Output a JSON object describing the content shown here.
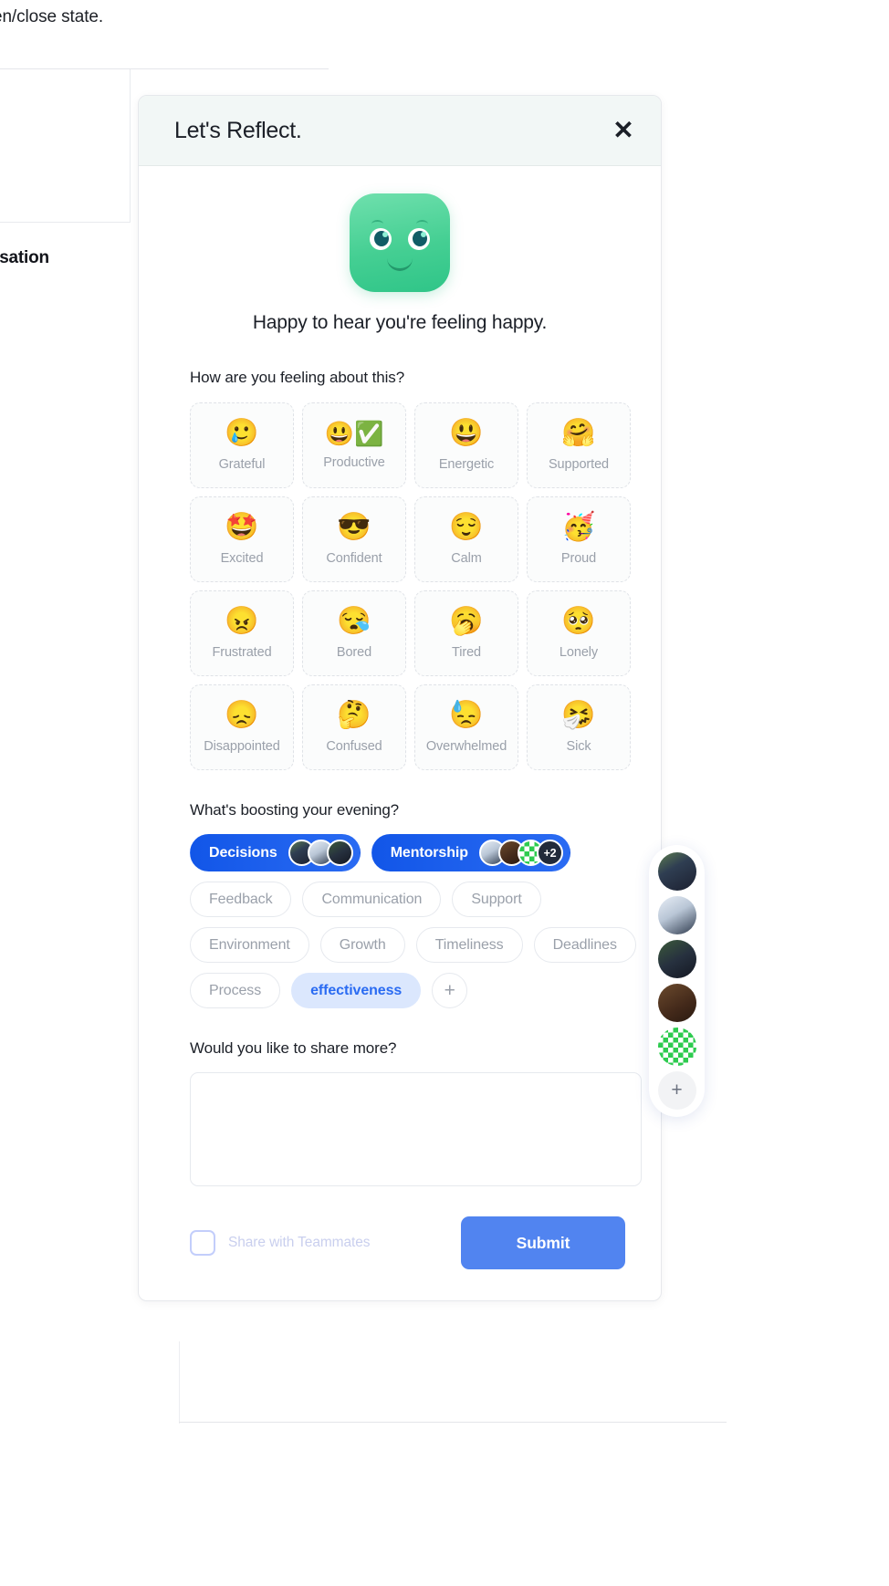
{
  "background": {
    "top_text": "en/close state.",
    "conversation_label": "rsation"
  },
  "modal": {
    "title": "Let's Reflect.",
    "close_icon": "close-icon",
    "mascot": {
      "name": "happy-mascot",
      "color": "#3ecb8f"
    },
    "mood_message": "Happy to hear you're feeling happy.",
    "feeling_question": "How are you feeling about this?",
    "emotions": [
      {
        "label": "Grateful",
        "emoji": "🥲",
        "selected": false
      },
      {
        "label": "Productive",
        "emoji": "😃",
        "selected": false,
        "badge": "✅"
      },
      {
        "label": "Energetic",
        "emoji": "😃",
        "selected": false
      },
      {
        "label": "Supported",
        "emoji": "🤗",
        "selected": false
      },
      {
        "label": "Excited",
        "emoji": "🤩",
        "selected": false
      },
      {
        "label": "Confident",
        "emoji": "😎",
        "selected": false
      },
      {
        "label": "Calm",
        "emoji": "😌",
        "selected": false
      },
      {
        "label": "Proud",
        "emoji": "🥳",
        "selected": false
      },
      {
        "label": "Frustrated",
        "emoji": "😠",
        "selected": false
      },
      {
        "label": "Bored",
        "emoji": "😪",
        "selected": false
      },
      {
        "label": "Tired",
        "emoji": "🥱",
        "selected": false
      },
      {
        "label": "Lonely",
        "emoji": "🥺",
        "selected": false
      },
      {
        "label": "Disappointed",
        "emoji": "😞",
        "selected": false
      },
      {
        "label": "Confused",
        "emoji": "🤔",
        "selected": false
      },
      {
        "label": "Overwhelmed",
        "emoji": "😓",
        "selected": false
      },
      {
        "label": "Sick",
        "emoji": "🤧",
        "selected": false
      }
    ],
    "boosting_question": "What's boosting your evening?",
    "topics": [
      {
        "label": "Decisions",
        "state": "selected",
        "avatars": [
          "av-a",
          "av-b",
          "av-c"
        ],
        "overflow": ""
      },
      {
        "label": "Mentorship",
        "state": "selected",
        "avatars": [
          "av-b",
          "av-d",
          "av-e"
        ],
        "overflow": "+2"
      },
      {
        "label": "Feedback",
        "state": "default"
      },
      {
        "label": "Communication",
        "state": "default"
      },
      {
        "label": "Support",
        "state": "default"
      },
      {
        "label": "Environment",
        "state": "default"
      },
      {
        "label": "Growth",
        "state": "default"
      },
      {
        "label": "Timeliness",
        "state": "default"
      },
      {
        "label": "Deadlines",
        "state": "default"
      },
      {
        "label": "Process",
        "state": "default"
      },
      {
        "label": "effectiveness",
        "state": "highlight"
      }
    ],
    "add_topic_icon": "plus-icon",
    "share_more_question": "Would you like to share more?",
    "share_more_value": "",
    "share_more_placeholder": "",
    "share_with_teammates_label": "Share with Teammates",
    "share_with_teammates_checked": false,
    "submit_label": "Submit",
    "accent_color": "#5184f0",
    "selected_chip_color": "#1d5fef",
    "highlight_chip_color": "#dbe7fd"
  },
  "avatar_rail": {
    "avatars": [
      "av-a",
      "av-b",
      "av-c",
      "av-d",
      "av-e"
    ],
    "add_icon": "plus-icon"
  }
}
